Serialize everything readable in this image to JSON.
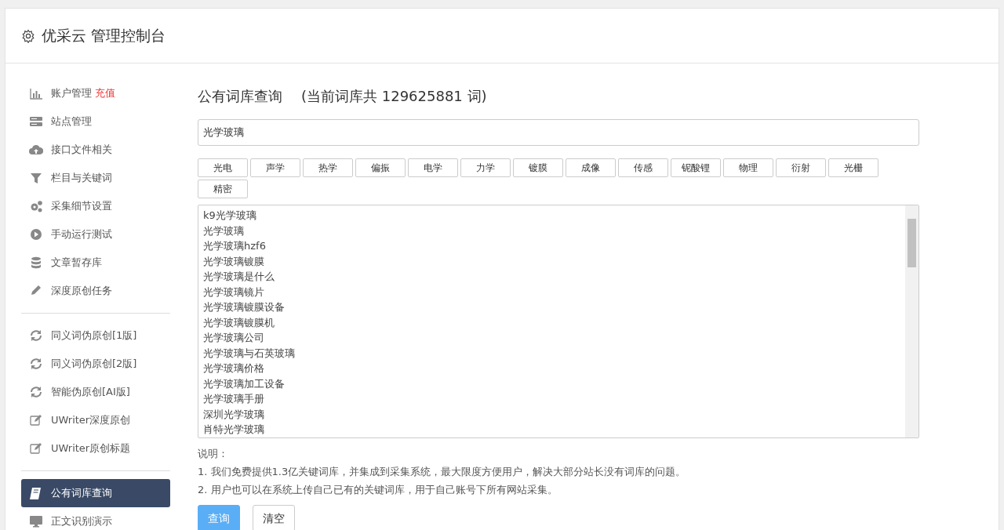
{
  "header": {
    "title": "优采云 管理控制台"
  },
  "sidebar": {
    "groups": [
      [
        {
          "label": "账户管理",
          "badge": "充值",
          "selected": false
        },
        {
          "label": "站点管理",
          "selected": false
        },
        {
          "label": "接口文件相关",
          "selected": false
        },
        {
          "label": "栏目与关键词",
          "selected": false
        },
        {
          "label": "采集细节设置",
          "selected": false
        },
        {
          "label": "手动运行测试",
          "selected": false
        },
        {
          "label": "文章暂存库",
          "selected": false
        },
        {
          "label": "深度原创任务",
          "selected": false
        }
      ],
      [
        {
          "label": "同义词伪原创[1版]",
          "selected": false
        },
        {
          "label": "同义词伪原创[2版]",
          "selected": false
        },
        {
          "label": "智能伪原创[AI版]",
          "selected": false
        },
        {
          "label": "UWriter深度原创",
          "selected": false
        },
        {
          "label": "UWriter原创标题",
          "selected": false
        }
      ],
      [
        {
          "label": "公有词库查询",
          "selected": true
        },
        {
          "label": "正文识别演示",
          "selected": false
        }
      ]
    ]
  },
  "main": {
    "title": "公有词库查询",
    "subtitle": "(当前词库共 129625881 词)",
    "search": {
      "value": "光学玻璃"
    },
    "tags": [
      "光电",
      "声学",
      "热学",
      "偏振",
      "电学",
      "力学",
      "镀膜",
      "成像",
      "传感",
      "铌酸锂",
      "物理",
      "衍射",
      "光栅",
      "精密"
    ],
    "results": [
      "k9光学玻璃",
      "光学玻璃",
      "光学玻璃hzf6",
      "光学玻璃镀膜",
      "光学玻璃是什么",
      "光学玻璃镜片",
      "光学玻璃镀膜设备",
      "光学玻璃镀膜机",
      "光学玻璃公司",
      "光学玻璃与石英玻璃",
      "光学玻璃价格",
      "光学玻璃加工设备",
      "光学玻璃手册",
      "深圳光学玻璃",
      "肖特光学玻璃"
    ],
    "notes_title": "说明：",
    "notes": [
      "1. 我们免费提供1.3亿关键词库，并集成到采集系统，最大限度方便用户，解决大部分站长没有词库的问题。",
      "2. 用户也可以在系统上传自己已有的关键词库，用于自己账号下所有网站采集。"
    ],
    "buttons": [
      {
        "label": "查询",
        "kind": "primary"
      },
      {
        "label": "清空",
        "kind": "secondary"
      }
    ]
  }
}
